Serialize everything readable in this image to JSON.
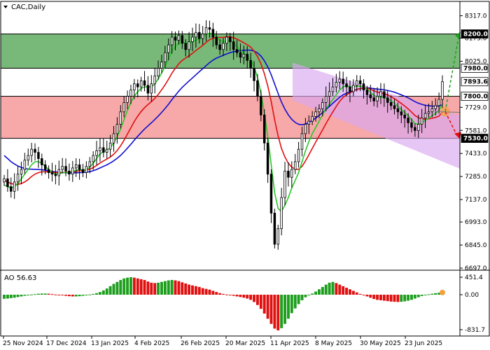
{
  "window": {
    "symbol_label": "CAC,Daily",
    "dropdown_icon": "triangle-down-icon"
  },
  "ao_panel": {
    "label": "AO 56.63",
    "y_ticks": [
      "451.4",
      "0.00",
      "-831.7"
    ],
    "positive_color": "#1e9e1e",
    "negative_color": "#e01010",
    "current_marker_color": "#f5a040"
  },
  "zones": {
    "green_zone": {
      "top": 8200.0,
      "bottom": 7980.0,
      "color": "#78b878"
    },
    "red_zone": {
      "top": 7800.0,
      "bottom": 7530.0,
      "color": "#f7a8a8"
    },
    "white_band": {
      "top": 7980.0,
      "bottom": 7800.0
    },
    "channel_color": "#d8a8f0"
  },
  "price_labels": [
    {
      "value": "8200.0",
      "style": "dark"
    },
    {
      "value": "7980.0",
      "style": "light"
    },
    {
      "value": "7893.6",
      "style": "light"
    },
    {
      "value": "7800.0",
      "style": "light"
    },
    {
      "value": "7530.0",
      "style": "dark"
    }
  ],
  "chart_data": {
    "type": "candlestick",
    "title": "CAC,Daily",
    "y_ticks": [
      8317.0,
      8173.0,
      8025.0,
      7729.0,
      7581.0,
      7433.0,
      7285.0,
      7137.0,
      6993.0,
      6845.0,
      6697.0
    ],
    "y_range": [
      6697.0,
      8400.0
    ],
    "x_labels": [
      "25 Nov 2024",
      "17 Dec 2024",
      "13 Jan 2025",
      "4 Feb 2025",
      "26 Feb 2025",
      "20 Mar 2025",
      "11 Apr 2025",
      "8 May 2025",
      "30 May 2025",
      "23 Jun 2025"
    ],
    "current_price": 7893.6,
    "levels": {
      "resistance_2": 8200.0,
      "resistance_1": 7980.0,
      "support_1": 7800.0,
      "support_2": 7530.0
    },
    "closes": [
      7270,
      7220,
      7190,
      7250,
      7300,
      7330,
      7390,
      7420,
      7460,
      7440,
      7400,
      7360,
      7330,
      7310,
      7300,
      7290,
      7330,
      7350,
      7320,
      7300,
      7340,
      7360,
      7330,
      7310,
      7350,
      7380,
      7420,
      7450,
      7470,
      7440,
      7460,
      7500,
      7560,
      7620,
      7700,
      7760,
      7800,
      7840,
      7880,
      7860,
      7900,
      7870,
      7820,
      7880,
      7930,
      7980,
      8020,
      8080,
      8130,
      8180,
      8160,
      8190,
      8140,
      8100,
      8150,
      8180,
      8210,
      8170,
      8200,
      8240,
      8230,
      8180,
      8130,
      8100,
      8140,
      8180,
      8150,
      8100,
      8080,
      8050,
      8070,
      8030,
      7980,
      7900,
      7800,
      7680,
      7500,
      7300,
      7050,
      6850,
      6950,
      7150,
      7320,
      7280,
      7330,
      7380,
      7460,
      7560,
      7620,
      7640,
      7670,
      7700,
      7720,
      7760,
      7800,
      7830,
      7860,
      7890,
      7910,
      7880,
      7860,
      7830,
      7870,
      7900,
      7880,
      7840,
      7810,
      7790,
      7770,
      7800,
      7830,
      7790,
      7760,
      7740,
      7720,
      7700,
      7680,
      7660,
      7630,
      7600,
      7580,
      7620,
      7660,
      7690,
      7700,
      7720,
      7740,
      7780,
      7893.6
    ],
    "ma_fast": {
      "name": "",
      "color": "#28c828",
      "values": [
        7230,
        7220,
        7210,
        7220,
        7240,
        7270,
        7300,
        7330,
        7360,
        7380,
        7380,
        7370,
        7350,
        7330,
        7310,
        7300,
        7300,
        7310,
        7310,
        7310,
        7315,
        7325,
        7330,
        7325,
        7330,
        7345,
        7370,
        7400,
        7430,
        7445,
        7455,
        7470,
        7500,
        7540,
        7590,
        7650,
        7710,
        7760,
        7800,
        7830,
        7850,
        7860,
        7860,
        7860,
        7880,
        7910,
        7950,
        7990,
        8040,
        8090,
        8120,
        8140,
        8150,
        8140,
        8140,
        8150,
        8160,
        8170,
        8180,
        8195,
        8205,
        8200,
        8185,
        8160,
        8150,
        8155,
        8155,
        8140,
        8120,
        8095,
        8075,
        8060,
        8035,
        7990,
        7920,
        7820,
        7690,
        7540,
        7360,
        7180,
        7080,
        7060,
        7100,
        7150,
        7210,
        7260,
        7310,
        7380,
        7450,
        7510,
        7560,
        7600,
        7640,
        7680,
        7720,
        7750,
        7780,
        7810,
        7840,
        7860,
        7870,
        7860,
        7860,
        7865,
        7865,
        7860,
        7845,
        7825,
        7805,
        7795,
        7795,
        7790,
        7785,
        7770,
        7755,
        7735,
        7715,
        7695,
        7675,
        7650,
        7625,
        7620,
        7630,
        7645,
        7660,
        7675,
        7690,
        7710,
        7750
      ]
    },
    "ma_mid": {
      "name": "",
      "color": "#e01010",
      "values": [
        7260,
        7250,
        7240,
        7235,
        7235,
        7240,
        7250,
        7265,
        7285,
        7300,
        7310,
        7315,
        7315,
        7315,
        7312,
        7310,
        7310,
        7310,
        7312,
        7312,
        7314,
        7318,
        7322,
        7324,
        7327,
        7332,
        7342,
        7356,
        7372,
        7385,
        7397,
        7410,
        7428,
        7452,
        7482,
        7518,
        7558,
        7598,
        7638,
        7672,
        7702,
        7727,
        7747,
        7765,
        7787,
        7812,
        7842,
        7874,
        7910,
        7948,
        7980,
        8008,
        8030,
        8045,
        8060,
        8076,
        8094,
        8110,
        8127,
        8146,
        8163,
        8173,
        8178,
        8177,
        8178,
        8181,
        8181,
        8176,
        8167,
        8155,
        8143,
        8131,
        8115,
        8090,
        8055,
        8008,
        7945,
        7865,
        7765,
        7648,
        7545,
        7465,
        7410,
        7370,
        7345,
        7332,
        7331,
        7350,
        7385,
        7425,
        7466,
        7506,
        7545,
        7584,
        7625,
        7663,
        7700,
        7735,
        7768,
        7793,
        7810,
        7822,
        7833,
        7843,
        7850,
        7853,
        7851,
        7845,
        7835,
        7827,
        7822,
        7816,
        7808,
        7797,
        7785,
        7770,
        7754,
        7737,
        7719,
        7698,
        7676,
        7662,
        7655,
        7653,
        7655,
        7659,
        7664,
        7672,
        7698
      ]
    },
    "ma_slow": {
      "name": "",
      "color": "#1010d0",
      "values": [
        7420,
        7400,
        7380,
        7365,
        7352,
        7343,
        7337,
        7333,
        7332,
        7331,
        7330,
        7328,
        7325,
        7322,
        7318,
        7315,
        7312,
        7310,
        7309,
        7308,
        7308,
        7309,
        7310,
        7311,
        7313,
        7316,
        7322,
        7330,
        7340,
        7350,
        7360,
        7372,
        7386,
        7402,
        7421,
        7443,
        7467,
        7492,
        7518,
        7543,
        7567,
        7590,
        7610,
        7630,
        7651,
        7673,
        7697,
        7722,
        7749,
        7778,
        7806,
        7833,
        7857,
        7878,
        7898,
        7918,
        7938,
        7958,
        7977,
        7997,
        8016,
        8032,
        8045,
        8054,
        8063,
        8072,
        8080,
        8086,
        8090,
        8093,
        8095,
        8097,
        8096,
        8090,
        8078,
        8058,
        8028,
        7988,
        7938,
        7878,
        7818,
        7763,
        7717,
        7680,
        7652,
        7632,
        7620,
        7617,
        7622,
        7632,
        7645,
        7660,
        7677,
        7695,
        7715,
        7735,
        7755,
        7775,
        7794,
        7809,
        7820,
        7829,
        7837,
        7844,
        7849,
        7852,
        7853,
        7852,
        7849,
        7846,
        7844,
        7841,
        7837,
        7832,
        7826,
        7818,
        7809,
        7800,
        7790,
        7778,
        7765,
        7755,
        7748,
        7742,
        7739,
        7737,
        7736,
        7737,
        7746
      ]
    },
    "ao_values": [
      -95,
      -90,
      -80,
      -70,
      -55,
      -40,
      -25,
      -10,
      5,
      15,
      25,
      30,
      30,
      25,
      15,
      5,
      -5,
      -15,
      -25,
      -35,
      -40,
      -40,
      -35,
      -25,
      -10,
      5,
      20,
      40,
      70,
      110,
      160,
      220,
      280,
      330,
      380,
      420,
      440,
      451,
      440,
      420,
      400,
      380,
      340,
      310,
      300,
      310,
      330,
      350,
      370,
      380,
      370,
      350,
      320,
      290,
      260,
      240,
      220,
      200,
      170,
      150,
      130,
      100,
      70,
      40,
      20,
      5,
      -10,
      -25,
      -40,
      -55,
      -70,
      -90,
      -120,
      -170,
      -240,
      -330,
      -440,
      -560,
      -680,
      -790,
      -831,
      -780,
      -680,
      -560,
      -430,
      -320,
      -220,
      -130,
      -60,
      -10,
      30,
      80,
      140,
      200,
      260,
      310,
      330,
      300,
      260,
      220,
      180,
      140,
      100,
      60,
      20,
      -10,
      -40,
      -70,
      -100,
      -120,
      -130,
      -140,
      -150,
      -160,
      -165,
      -170,
      -165,
      -155,
      -140,
      -120,
      -90,
      -60,
      -30,
      -10,
      10,
      25,
      40,
      50,
      57
    ],
    "channel": {
      "upper_start": 7980.0,
      "upper_end": 7640.0,
      "lower_start": 7820.0,
      "lower_end": 7380.0
    }
  }
}
